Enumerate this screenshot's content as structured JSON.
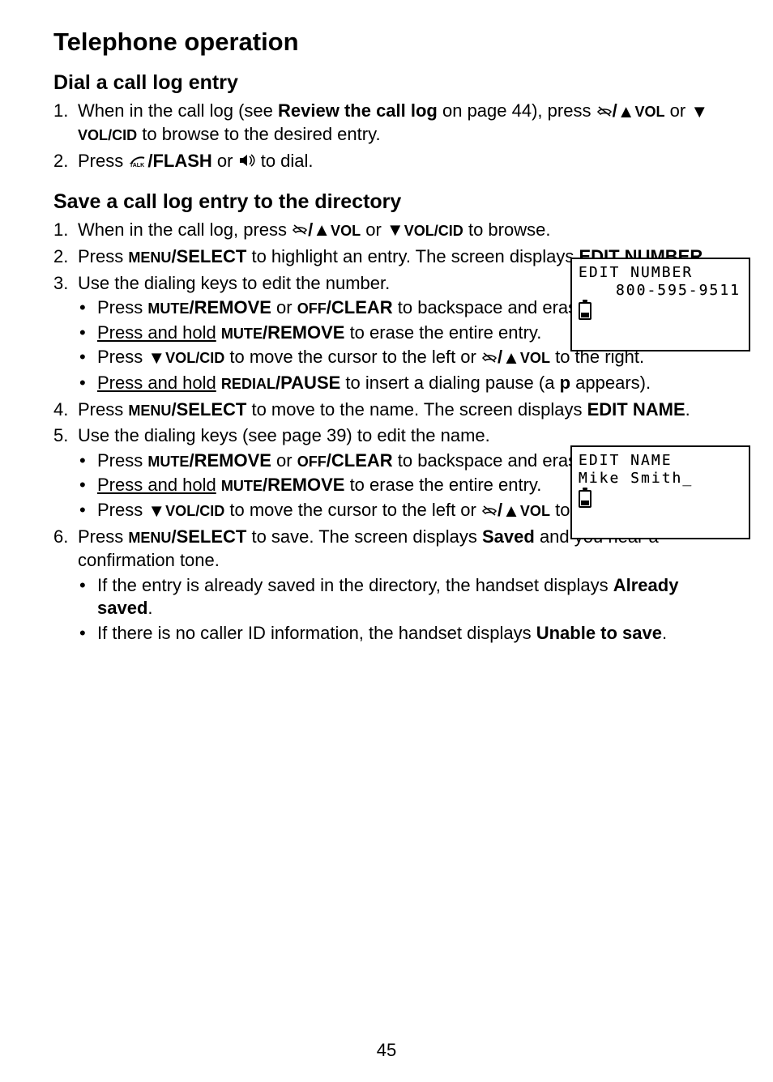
{
  "page_title": "Telephone operation",
  "section1": {
    "heading": "Dial a call log entry",
    "step1_a": "When in the call log (see ",
    "step1_b": "Review the call log",
    "step1_c": " on page 44), press ",
    "step1_vol": "VOL",
    "step1_or": " or ",
    "step1_volcid": "VOL/CID",
    "step1_d": " to browse to the desired entry.",
    "step2_a": "Press ",
    "step2_flash": "/FLASH",
    "step2_or": " or ",
    "step2_b": " to dial."
  },
  "section2": {
    "heading": "Save a call log entry to the directory",
    "s1_a": "When in the call log, press ",
    "s1_vol": "VOL",
    "s1_or": " or ",
    "s1_volcid": "VOL/CID",
    "s1_b": " to browse.",
    "s2_a": "Press ",
    "s2_menu": "MENU",
    "s2_select": "/SELECT",
    "s2_b": " to highlight an entry. The screen displays ",
    "s2_editnum": "EDIT NUMBER",
    "s2_c": ".",
    "s3": "Use the dialing keys to edit the number.",
    "s3b1_a": "Press ",
    "s3b1_mute": "MUTE",
    "s3b1_remove": "/REMOVE",
    "s3b1_or": " or ",
    "s3b1_off": "OFF",
    "s3b1_clear": "/CLEAR",
    "s3b1_b": " to backspace and erase a digit.",
    "s3b2_a": "Press and hold",
    "s3b2_mute": "MUTE",
    "s3b2_remove": "/REMOVE",
    "s3b2_b": " to erase the entire entry.",
    "s3b3_a": "Press ",
    "s3b3_volcid": "VOL/CID",
    "s3b3_b": " to move the cursor to the left or ",
    "s3b3_vol": "VOL",
    "s3b3_c": " to the right.",
    "s3b4_a": "Press and hold",
    "s3b4_redial": "REDIAL",
    "s3b4_pause": "/PAUSE",
    "s3b4_b": " to insert a dialing pause (a ",
    "s3b4_p": "p",
    "s3b4_c": " appears).",
    "s4_a": "Press ",
    "s4_menu": "MENU",
    "s4_select": "/SELECT",
    "s4_b": " to move to the name. The screen displays ",
    "s4_editname": "EDIT NAME",
    "s4_c": ".",
    "s5": "Use the dialing keys (see page 39) to edit the name.",
    "s5b1_a": "Press ",
    "s5b1_mute": "MUTE",
    "s5b1_remove": "/REMOVE",
    "s5b1_or": " or ",
    "s5b1_off": "OFF",
    "s5b1_clear": "/CLEAR",
    "s5b1_b": " to backspace and erase a character.",
    "s5b2_a": "Press and hold",
    "s5b2_mute": "MUTE",
    "s5b2_remove": "/REMOVE",
    "s5b2_b": " to erase the entire entry.",
    "s5b3_a": "Press ",
    "s5b3_volcid": "VOL/CID",
    "s5b3_b": " to move the cursor to the left or ",
    "s5b3_vol": "VOL",
    "s5b3_c": " to the right.",
    "s6_a": "Press ",
    "s6_menu": "MENU",
    "s6_select": "/SELECT",
    "s6_b": " to save. The screen displays ",
    "s6_saved": "Saved",
    "s6_c": " and you hear a confirmation tone.",
    "s6b1_a": "If the entry is already saved in the directory, the handset displays ",
    "s6b1_already": "Already saved",
    "s6b1_c": ".",
    "s6b2_a": "If there is no caller ID information, the handset displays ",
    "s6b2_unable": "Unable to save",
    "s6b2_c": "."
  },
  "screen1": {
    "line1": "EDIT NUMBER",
    "line2": "800-595-9511"
  },
  "screen2": {
    "line1": "EDIT NAME",
    "line2": "Mike Smith_"
  },
  "page_number": "45"
}
